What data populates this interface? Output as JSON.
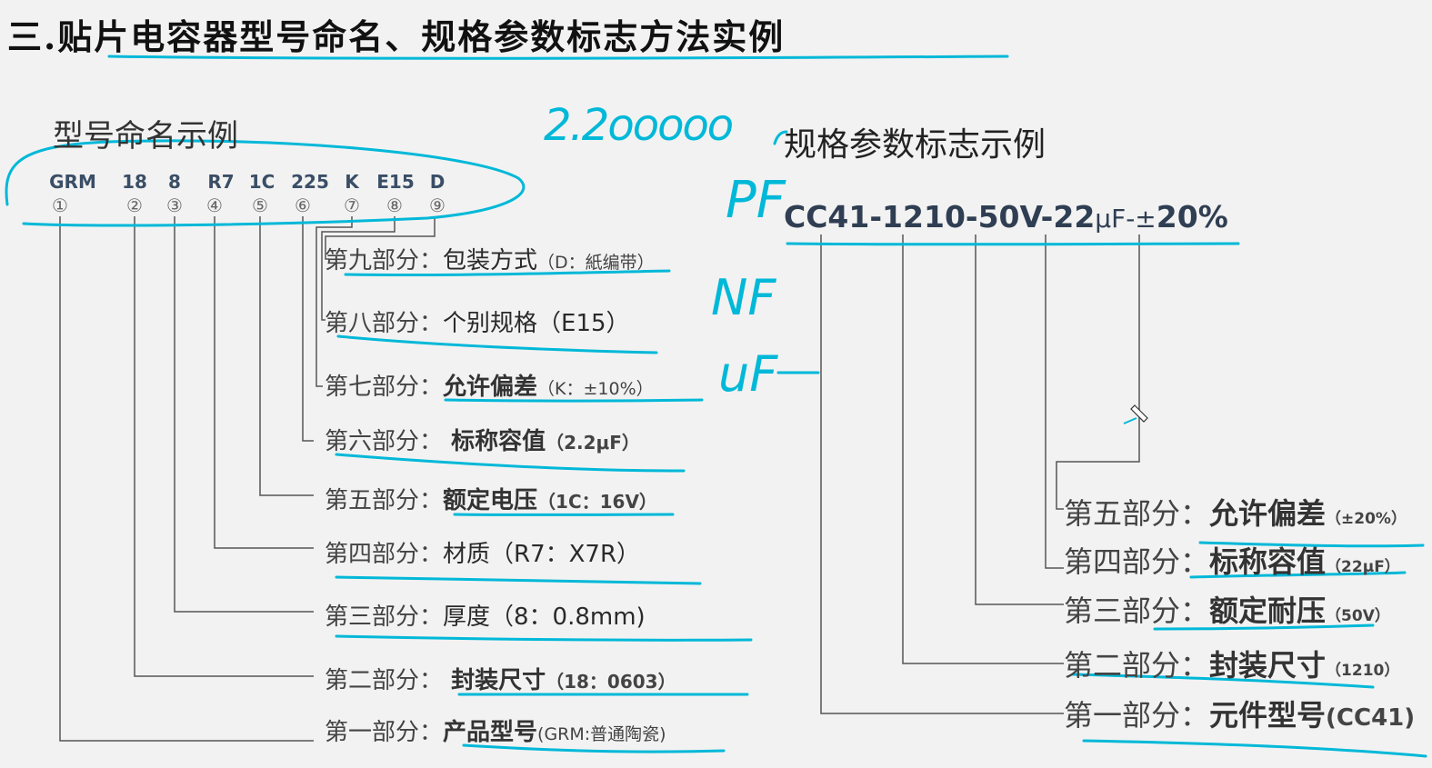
{
  "title": "三.贴片电容器型号命名、规格参数标志方法实例",
  "left": {
    "heading": "型号命名示例",
    "codes": [
      {
        "text": "GRM",
        "num": "①"
      },
      {
        "text": "18",
        "num": "②"
      },
      {
        "text": "8",
        "num": "③"
      },
      {
        "text": "R7",
        "num": "④"
      },
      {
        "text": "1C",
        "num": "⑤"
      },
      {
        "text": "225",
        "num": "⑥"
      },
      {
        "text": "K",
        "num": "⑦"
      },
      {
        "text": "E15",
        "num": "⑧"
      },
      {
        "text": "D",
        "num": "⑨"
      }
    ],
    "parts": [
      {
        "label": "第九部分：",
        "value": "包装方式",
        "detail": "（D：紙编带）"
      },
      {
        "label": "第八部分：",
        "value": "个别规格（E15）",
        "detail": ""
      },
      {
        "label": "第七部分：",
        "value": "允许偏差",
        "detail": "（K：±10%）"
      },
      {
        "label": "第六部分：",
        "value": " 标称容值",
        "detail": "（2.2μF）"
      },
      {
        "label": "第五部分：",
        "value": "额定电压",
        "detail": "（1C：16V）"
      },
      {
        "label": "第四部分：",
        "value": "材质（R7：X7R）",
        "detail": ""
      },
      {
        "label": "第三部分：",
        "value": "厚度（8：0.8mm)",
        "detail": ""
      },
      {
        "label": "第二部分：",
        "value": " 封装尺寸",
        "detail": "（18：0603）"
      },
      {
        "label": "第一部分：",
        "value": "产品型号",
        "detail": "(GRM:普通陶瓷)"
      }
    ]
  },
  "right": {
    "heading": "规格参数标志示例",
    "spec": {
      "main": "CC41-1210-50V-22",
      "unit": "μF-±",
      "tol": "20%"
    },
    "parts": [
      {
        "label": "第五部分：",
        "value": "允许偏差",
        "detail": "（±20%）"
      },
      {
        "label": "第四部分：",
        "value": "标称容值",
        "detail": "（22μF）"
      },
      {
        "label": "第三部分：",
        "value": "额定耐压",
        "detail": "（50V）"
      },
      {
        "label": "第二部分：",
        "value": "封装尺寸",
        "detail": "（1210）"
      },
      {
        "label": "第一部分：",
        "value": "元件型号",
        "detail": "(CC41)"
      }
    ]
  },
  "handwriting": {
    "h1": "2.2ooooo",
    "h2": "PF",
    "h3": "NF",
    "h4": "uF"
  },
  "colors": {
    "highlight": "#00b8d8",
    "lines": "#555555"
  }
}
